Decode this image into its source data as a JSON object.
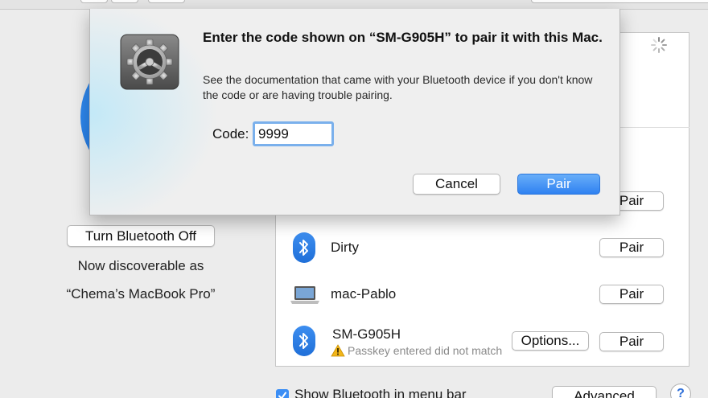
{
  "bluetooth": {
    "turn_off_label": "Turn Bluetooth Off",
    "discoverable_text": "Now discoverable as",
    "computer_name": "“Chema’s MacBook Pro”"
  },
  "devices": [
    {
      "name": "",
      "icon": "bluetooth-icon",
      "action_label": "Pair"
    },
    {
      "name": "Dirty",
      "icon": "bluetooth-icon",
      "action_label": "Pair"
    },
    {
      "name": "mac-Pablo",
      "icon": "laptop-icon",
      "action_label": "Pair"
    },
    {
      "name": "SM-G905H",
      "icon": "bluetooth-icon",
      "status": "Passkey entered did not match",
      "options_label": "Options...",
      "action_label": "Pair"
    }
  ],
  "footer": {
    "show_in_menu_bar_label": "Show Bluetooth in menu bar",
    "show_in_menu_bar_checked": true,
    "advanced_label": "Advanced",
    "help_label": "?"
  },
  "dialog": {
    "title": "Enter the code shown on “SM-G905H” to pair it with this Mac.",
    "message": "See the documentation that came with your Bluetooth device if you don't know the code or are having trouble pairing.",
    "code_label": "Code:",
    "code_value": "9999",
    "cancel_label": "Cancel",
    "pair_label": "Pair",
    "icon": "gear-icon"
  },
  "colors": {
    "accent": "#3b8ef5",
    "bluetooth_blue": "#2a7be4",
    "warning": "#f2b619"
  }
}
